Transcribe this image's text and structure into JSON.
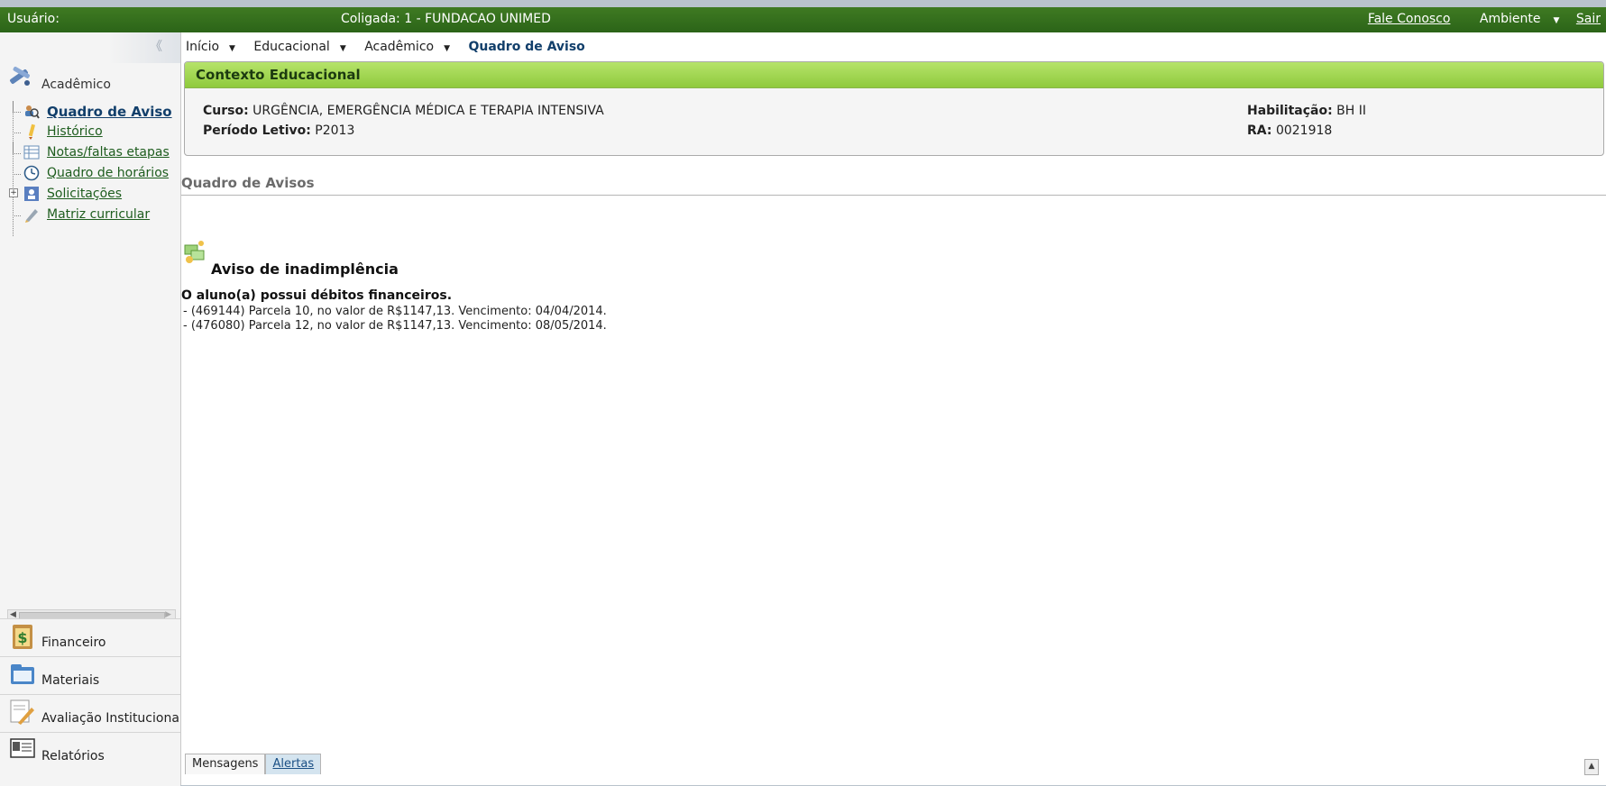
{
  "topbar": {
    "user_label": "Usuário:",
    "coligada": "Coligada: 1 - FUNDACAO UNIMED",
    "fale_conosco": "Fale Conosco",
    "ambiente": "Ambiente",
    "sair": "Sair"
  },
  "sidebar": {
    "collapse_glyph": "《",
    "section_label": "Acadêmico",
    "items": [
      {
        "label": "Quadro de Aviso",
        "icon": "search-people-icon"
      },
      {
        "label": "Histórico",
        "icon": "pencil-icon"
      },
      {
        "label": "Notas/faltas etapas",
        "icon": "grid-icon"
      },
      {
        "label": "Quadro de horários",
        "icon": "clock-icon"
      },
      {
        "label": "Solicitações",
        "icon": "request-icon"
      },
      {
        "label": "Matriz curricular",
        "icon": "edit-icon"
      }
    ],
    "bottom_sections": [
      {
        "label": "Financeiro",
        "icon": "money-clipboard-icon"
      },
      {
        "label": "Materiais",
        "icon": "folder-icon"
      },
      {
        "label": "Avaliação Institucional",
        "icon": "notepad-pencil-icon"
      },
      {
        "label": "Relatórios",
        "icon": "report-icon"
      }
    ]
  },
  "breadcrumb": {
    "inicio": "Início",
    "educacional": "Educacional",
    "academico": "Acadêmico",
    "current": "Quadro de Aviso"
  },
  "contexto": {
    "title": "Contexto Educacional",
    "curso_label": "Curso:",
    "curso_value": "URGÊNCIA, EMERGÊNCIA MÉDICA E TERAPIA INTENSIVA",
    "periodo_label": "Período Letivo:",
    "periodo_value": "P2013",
    "habilitacao_label": "Habilitação:",
    "habilitacao_value": "BH II",
    "ra_label": "RA:",
    "ra_value": "0021918"
  },
  "quadro": {
    "title": "Quadro de Avisos",
    "aviso_title": "Aviso de inadimplência",
    "subtitle": "O aluno(a) possui débitos financeiros.",
    "lines": [
      " - (469144) Parcela 10, no valor de R$1147,13. Vencimento: 04/04/2014.",
      " - (476080) Parcela 12, no valor de R$1147,13. Vencimento: 08/05/2014."
    ]
  },
  "bottom_tabs": {
    "mensagens": "Mensagens",
    "alertas": "Alertas"
  }
}
